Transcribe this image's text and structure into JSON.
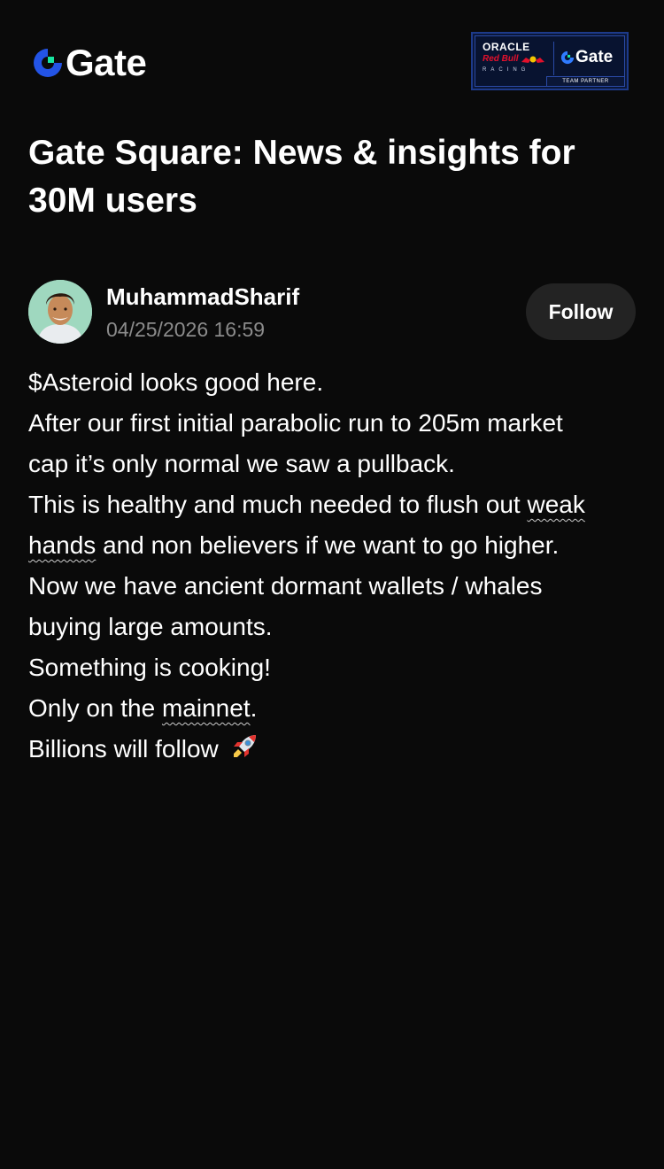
{
  "header": {
    "logo_text": "Gate",
    "partner_badge": {
      "oracle": "ORACLE",
      "redbull": "Red Bull",
      "racing": "RACING",
      "gate": "Gate",
      "team_partner": "TEAM PARTNER"
    }
  },
  "page_title": "Gate Square: News & insights for 30M users",
  "post": {
    "author_name": "MuhammadSharif",
    "timestamp": "04/25/2026 16:59",
    "follow_label": "Follow",
    "lines": [
      "$Asteroid looks good here.",
      "After our first initial parabolic run to 205m market",
      "cap it’s only normal we saw a pullback.",
      "This is healthy and much needed to flush out ",
      "weak",
      "hands",
      " and non believers if we want to go higher.",
      "Now we have ancient dormant wallets / whales",
      "buying large amounts.",
      "Something is cooking!",
      "Only on the ",
      "mainnet",
      ".",
      "Billions will follow "
    ],
    "emoji": "rocket-icon"
  },
  "colors": {
    "background": "#0a0a0a",
    "gate_blue": "#2354e6",
    "gate_green": "#17e6a1",
    "muted_text": "#8b8b8b",
    "button_bg": "#232323"
  }
}
